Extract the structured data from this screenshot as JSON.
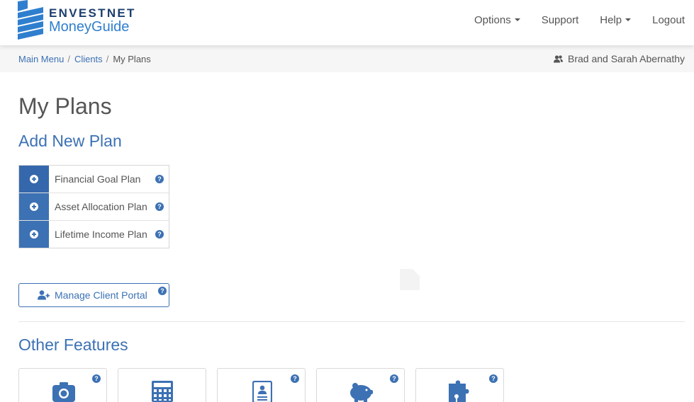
{
  "brand": {
    "line1": "ENVESTNET",
    "line2": "MoneyGuide",
    "logo_color": "#2f7fce",
    "logo_dark": "#1d3f6e"
  },
  "nav": {
    "options": "Options",
    "support": "Support",
    "help": "Help",
    "logout": "Logout"
  },
  "breadcrumb": {
    "main_menu": "Main Menu",
    "clients": "Clients",
    "current": "My Plans",
    "separator": "/"
  },
  "client": {
    "name": "Brad and Sarah Abernathy",
    "icon": "users-icon"
  },
  "page": {
    "title": "My Plans",
    "add_new_plan": "Add New Plan",
    "other_features": "Other Features"
  },
  "plans": [
    {
      "label": "Financial Goal Plan",
      "add_icon": "plus-circle-icon",
      "help_icon": "question-circle-icon"
    },
    {
      "label": "Asset Allocation Plan",
      "add_icon": "plus-circle-icon",
      "help_icon": "question-circle-icon"
    },
    {
      "label": "Lifetime Income Plan",
      "add_icon": "plus-circle-icon",
      "help_icon": "question-circle-icon"
    }
  ],
  "portal": {
    "label": "Manage Client Portal",
    "icon": "user-plus-icon"
  },
  "help_glyph": "?",
  "features": [
    {
      "icon": "camera-icon",
      "has_help": true
    },
    {
      "icon": "calculator-icon",
      "has_help": false
    },
    {
      "icon": "document-icon",
      "has_help": true
    },
    {
      "icon": "piggy-bank-icon",
      "has_help": true
    },
    {
      "icon": "puzzle-icon",
      "has_help": true
    }
  ],
  "colors": {
    "accent": "#3c71b4",
    "text": "#555555",
    "crumb_bg": "#f6f6f6"
  }
}
